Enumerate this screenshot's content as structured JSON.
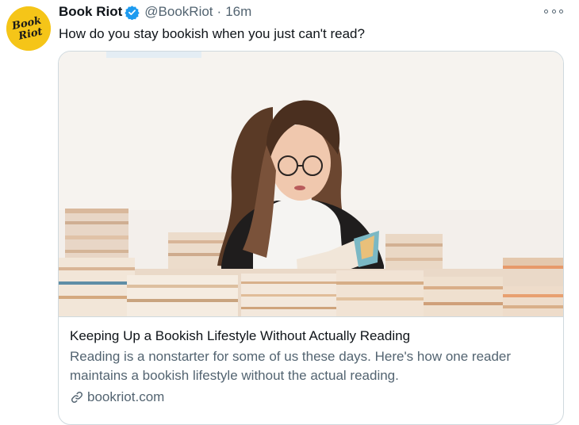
{
  "tweet": {
    "display_name": "Book Riot",
    "verified_icon": "verified-badge-icon",
    "handle": "@BookRiot",
    "separator": "·",
    "time": "16m",
    "more_icon": "more-options-icon",
    "text": "How do you stay bookish when you just can't read?",
    "avatar_logo_text": "Book Riot"
  },
  "card": {
    "title": "Keeping Up a Bookish Lifestyle Without Actually Reading",
    "description": "Reading is a nonstarter for some of us these days. Here's how one reader maintains a bookish lifestyle without the actual reading.",
    "link_icon": "link-icon",
    "domain": "bookriot.com",
    "image_subject": "photo-woman-reading-among-books"
  },
  "colors": {
    "avatar_bg": "#f5c518",
    "verified_blue": "#1d9bf0",
    "muted_text": "#536471",
    "border": "#cfd9de"
  }
}
